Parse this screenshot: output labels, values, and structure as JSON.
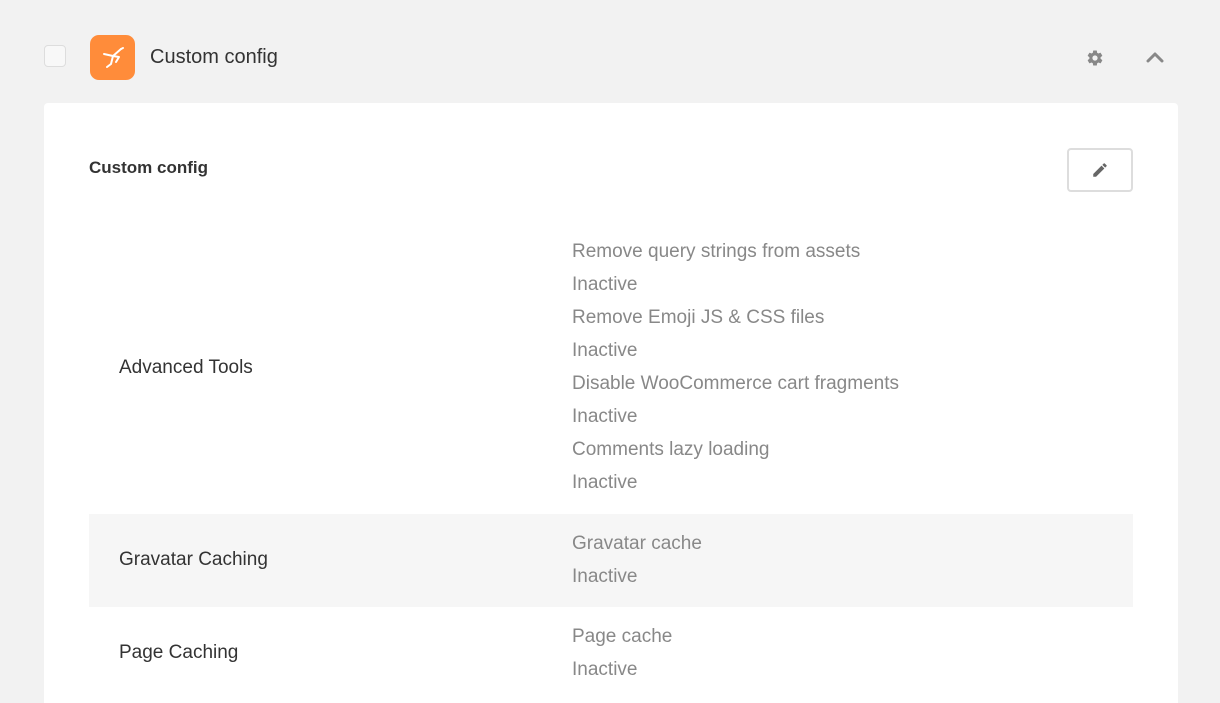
{
  "header": {
    "title": "Custom config",
    "icon": "hummingbird-logo-icon",
    "brand_color": "#ff8c3a"
  },
  "panel": {
    "title": "Custom config",
    "edit_icon": "pencil-icon",
    "rows": [
      {
        "label": "Advanced Tools",
        "values": [
          "Remove query strings from assets",
          "Inactive",
          "Remove Emoji JS & CSS files",
          "Inactive",
          "Disable WooCommerce cart fragments",
          "Inactive",
          "Comments lazy loading",
          "Inactive"
        ]
      },
      {
        "label": "Gravatar Caching",
        "values": [
          "Gravatar cache",
          "Inactive"
        ]
      },
      {
        "label": "Page Caching",
        "values": [
          "Page cache",
          "Inactive"
        ]
      }
    ]
  }
}
